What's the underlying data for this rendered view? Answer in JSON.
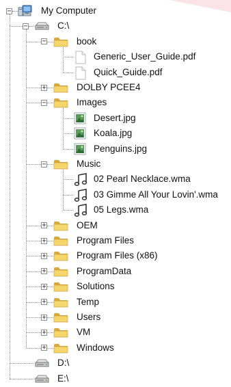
{
  "tree": {
    "root": {
      "label": "My Computer",
      "expanded": true,
      "icon": "computer-icon"
    },
    "drives": [
      {
        "label": "C:\\",
        "expanded": true,
        "icon": "drive-icon"
      },
      {
        "label": "D:\\",
        "expanded": false,
        "icon": "drive-icon"
      },
      {
        "label": "E:\\",
        "expanded": false,
        "icon": "drive-icon"
      }
    ],
    "c_items": [
      {
        "label": "book",
        "type": "folder",
        "expanded": true,
        "children": [
          {
            "label": "Generic_User_Guide.pdf",
            "type": "document"
          },
          {
            "label": "Quick_Guide.pdf",
            "type": "document"
          }
        ]
      },
      {
        "label": "DOLBY PCEE4",
        "type": "folder",
        "expanded": false
      },
      {
        "label": "Images",
        "type": "folder",
        "expanded": true,
        "children": [
          {
            "label": "Desert.jpg",
            "type": "image"
          },
          {
            "label": "Koala.jpg",
            "type": "image"
          },
          {
            "label": "Penguins.jpg",
            "type": "image"
          }
        ]
      },
      {
        "label": "Music",
        "type": "folder",
        "expanded": true,
        "children": [
          {
            "label": "02 Pearl Necklace.wma",
            "type": "audio"
          },
          {
            "label": "03 Gimme All Your Lovin'.wma",
            "type": "audio"
          },
          {
            "label": "05 Legs.wma",
            "type": "audio"
          }
        ]
      },
      {
        "label": "OEM",
        "type": "folder",
        "expanded": false
      },
      {
        "label": "Program Files",
        "type": "folder",
        "expanded": false
      },
      {
        "label": "Program Files (x86)",
        "type": "folder",
        "expanded": false
      },
      {
        "label": "ProgramData",
        "type": "folder",
        "expanded": false
      },
      {
        "label": "Solutions",
        "type": "folder",
        "expanded": false
      },
      {
        "label": "Temp",
        "type": "folder",
        "expanded": false
      },
      {
        "label": "Users",
        "type": "folder",
        "expanded": false
      },
      {
        "label": "VM",
        "type": "folder",
        "expanded": false
      },
      {
        "label": "Windows",
        "type": "folder",
        "expanded": false
      }
    ],
    "toggle_symbols": {
      "expanded": "−",
      "collapsed": "+"
    },
    "colors": {
      "folder": "#f5d66b",
      "folder_dark": "#d9a93a",
      "line": "#8a8a8a",
      "music": "#333333"
    }
  }
}
